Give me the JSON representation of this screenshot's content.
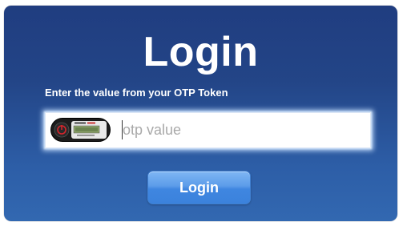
{
  "login_panel": {
    "title": "Login",
    "instruction": "Enter the value from your OTP Token",
    "otp_field": {
      "value": "",
      "placeholder": "otp value",
      "icon": "otp-token-icon"
    },
    "submit_label": "Login"
  },
  "colors": {
    "panel_top": "#203d80",
    "panel_bottom": "#3268b1",
    "button": "#4a8fe4",
    "text": "#ffffff",
    "placeholder": "#a9a9a9"
  }
}
